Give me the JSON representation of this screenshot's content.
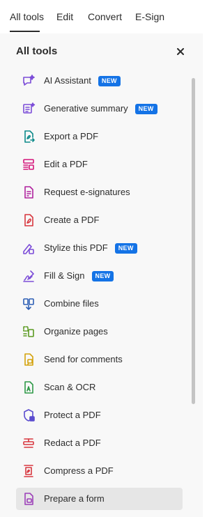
{
  "tabs": [
    {
      "label": "All tools",
      "active": true
    },
    {
      "label": "Edit"
    },
    {
      "label": "Convert"
    },
    {
      "label": "E-Sign"
    }
  ],
  "panel": {
    "title": "All tools",
    "close_icon": "close-icon"
  },
  "badge_label": "NEW",
  "tools": [
    {
      "label": "AI Assistant",
      "icon": "ai-assistant-icon",
      "color": "#7c4dd8",
      "badge": true
    },
    {
      "label": "Generative summary",
      "icon": "generative-summary-icon",
      "color": "#7c4dd8",
      "badge": true
    },
    {
      "label": "Export a PDF",
      "icon": "export-pdf-icon",
      "color": "#0d8a8a"
    },
    {
      "label": "Edit a PDF",
      "icon": "edit-pdf-icon",
      "color": "#d4167a"
    },
    {
      "label": "Request e-signatures",
      "icon": "request-esign-icon",
      "color": "#b0229e"
    },
    {
      "label": "Create a PDF",
      "icon": "create-pdf-icon",
      "color": "#d7373f"
    },
    {
      "label": "Stylize this PDF",
      "icon": "stylize-pdf-icon",
      "color": "#7c4dd8",
      "badge": true
    },
    {
      "label": "Fill & Sign",
      "icon": "fill-sign-icon",
      "color": "#7c4dd8",
      "badge": true
    },
    {
      "label": "Combine files",
      "icon": "combine-files-icon",
      "color": "#2d5fb5"
    },
    {
      "label": "Organize pages",
      "icon": "organize-pages-icon",
      "color": "#5a9a21"
    },
    {
      "label": "Send for comments",
      "icon": "send-comments-icon",
      "color": "#d4a20c"
    },
    {
      "label": "Scan & OCR",
      "icon": "scan-ocr-icon",
      "color": "#2e9947"
    },
    {
      "label": "Protect a PDF",
      "icon": "protect-pdf-icon",
      "color": "#5b4ccf"
    },
    {
      "label": "Redact a PDF",
      "icon": "redact-pdf-icon",
      "color": "#d7373f"
    },
    {
      "label": "Compress a PDF",
      "icon": "compress-pdf-icon",
      "color": "#d7373f"
    },
    {
      "label": "Prepare a form",
      "icon": "prepare-form-icon",
      "color": "#9c3fb8",
      "selected": true
    }
  ]
}
